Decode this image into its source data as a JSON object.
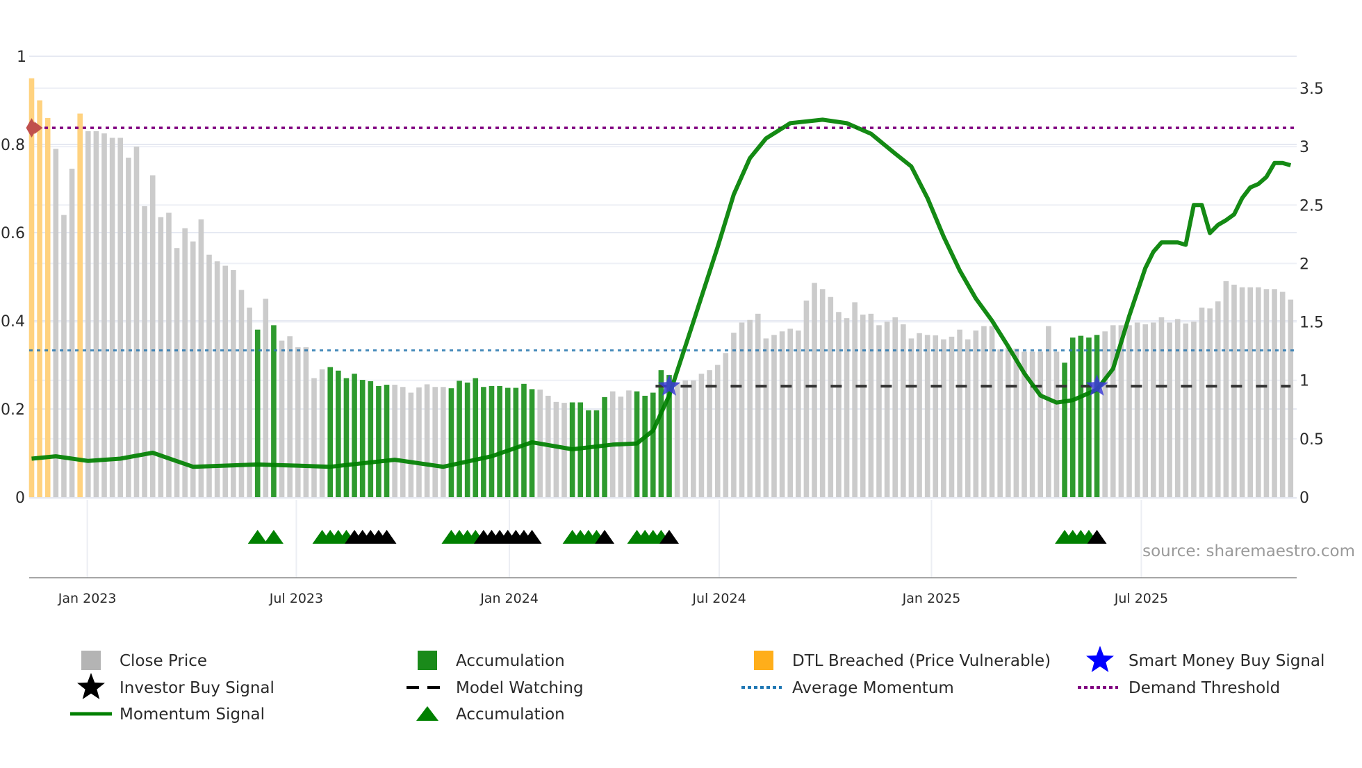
{
  "chart_data": {
    "type": "bar",
    "title": "",
    "source": "source: sharemaestro.com",
    "left_axis": {
      "ticks": [
        0,
        0.2,
        0.4,
        0.6,
        0.8,
        1
      ],
      "labels": [
        "0",
        "0.2",
        "0.4",
        "0.6",
        "0.8",
        "1"
      ],
      "range": [
        0,
        1
      ]
    },
    "right_axis": {
      "ticks": [
        0,
        0.5,
        1,
        1.5,
        2,
        2.5,
        3,
        3.5
      ],
      "labels": [
        "0",
        "0.5",
        "1",
        "1.5",
        "2",
        "2.5",
        "3",
        "3.5"
      ],
      "range": [
        0,
        3.77
      ]
    },
    "x_ticks": [
      {
        "label": "Jan 2023",
        "week": 6.9
      },
      {
        "label": "Jul 2023",
        "week": 32.8
      },
      {
        "label": "Jan 2024",
        "week": 59.2
      },
      {
        "label": "Jul 2024",
        "week": 85.2
      },
      {
        "label": "Jan 2025",
        "week": 111.5
      },
      {
        "label": "Jul 2025",
        "week": 137.5
      }
    ],
    "close_price": [
      0.95,
      0.9,
      0.86,
      0.79,
      0.64,
      0.745,
      0.87,
      0.83,
      0.83,
      0.825,
      0.815,
      0.815,
      0.77,
      0.795,
      0.66,
      0.73,
      0.635,
      0.645,
      0.565,
      0.61,
      0.58,
      0.63,
      0.55,
      0.535,
      0.525,
      0.515,
      0.47,
      0.43,
      0.38,
      0.45,
      0.39,
      0.355,
      0.365,
      0.34,
      0.34,
      0.27,
      0.29,
      0.295,
      0.287,
      0.27,
      0.28,
      0.266,
      0.263,
      0.252,
      0.255,
      0.255,
      0.25,
      0.237,
      0.249,
      0.256,
      0.25,
      0.25,
      0.247,
      0.264,
      0.26,
      0.27,
      0.25,
      0.252,
      0.252,
      0.248,
      0.248,
      0.257,
      0.245,
      0.244,
      0.23,
      0.216,
      0.214,
      0.215,
      0.215,
      0.197,
      0.197,
      0.227,
      0.24,
      0.228,
      0.242,
      0.24,
      0.23,
      0.237,
      0.288,
      0.277,
      0.26,
      0.265,
      0.265,
      0.28,
      0.288,
      0.3,
      0.327,
      0.373,
      0.396,
      0.402,
      0.416,
      0.36,
      0.368,
      0.376,
      0.382,
      0.378,
      0.446,
      0.486,
      0.472,
      0.454,
      0.42,
      0.406,
      0.442,
      0.414,
      0.416,
      0.39,
      0.398,
      0.408,
      0.392,
      0.36,
      0.372,
      0.368,
      0.367,
      0.358,
      0.364,
      0.38,
      0.358,
      0.378,
      0.388,
      0.388,
      0.335,
      0.339,
      0.337,
      0.33,
      0.33,
      0.33,
      0.388,
      0.33,
      0.305,
      0.362,
      0.366,
      0.362,
      0.368,
      0.376,
      0.39,
      0.39,
      0.39,
      0.396,
      0.392,
      0.396,
      0.408,
      0.396,
      0.404,
      0.394,
      0.398,
      0.43,
      0.428,
      0.444,
      0.49,
      0.482,
      0.476,
      0.476,
      0.476,
      0.472,
      0.472,
      0.466,
      0.448
    ],
    "dtl_breached_weeks": [
      0,
      1,
      2,
      6
    ],
    "accumulation_weeks": [
      28,
      30,
      37,
      38,
      39,
      40,
      41,
      42,
      43,
      44,
      52,
      53,
      54,
      55,
      56,
      57,
      58,
      59,
      60,
      61,
      62,
      67,
      68,
      69,
      70,
      71,
      75,
      76,
      77,
      78,
      79,
      128,
      129,
      130,
      131,
      132
    ],
    "momentum_signal": [
      [
        0,
        0.33
      ],
      [
        3,
        0.35
      ],
      [
        7,
        0.31
      ],
      [
        11,
        0.33
      ],
      [
        15,
        0.38
      ],
      [
        20,
        0.26
      ],
      [
        28,
        0.28
      ],
      [
        33,
        0.27
      ],
      [
        37,
        0.26
      ],
      [
        45,
        0.32
      ],
      [
        51,
        0.26
      ],
      [
        57,
        0.35
      ],
      [
        62,
        0.47
      ],
      [
        67,
        0.41
      ],
      [
        72,
        0.45
      ],
      [
        75,
        0.46
      ],
      [
        77,
        0.57
      ],
      [
        79,
        0.87
      ],
      [
        82,
        1.5
      ],
      [
        85,
        2.14
      ],
      [
        87,
        2.59
      ],
      [
        89,
        2.9
      ],
      [
        91,
        3.07
      ],
      [
        94,
        3.2
      ],
      [
        98,
        3.23
      ],
      [
        101,
        3.2
      ],
      [
        104,
        3.11
      ],
      [
        107,
        2.94
      ],
      [
        109,
        2.83
      ],
      [
        111,
        2.56
      ],
      [
        113,
        2.23
      ],
      [
        115,
        1.94
      ],
      [
        117,
        1.7
      ],
      [
        119,
        1.51
      ],
      [
        121,
        1.29
      ],
      [
        123,
        1.06
      ],
      [
        125,
        0.87
      ],
      [
        127,
        0.81
      ],
      [
        129,
        0.83
      ],
      [
        132,
        0.92
      ],
      [
        134,
        1.1
      ],
      [
        136,
        1.55
      ],
      [
        138,
        1.96
      ],
      [
        139,
        2.1
      ],
      [
        140,
        2.18
      ],
      [
        142,
        2.18
      ],
      [
        143,
        2.16
      ],
      [
        144,
        2.5
      ],
      [
        145,
        2.5
      ],
      [
        146,
        2.26
      ],
      [
        147,
        2.33
      ],
      [
        148,
        2.37
      ],
      [
        149,
        2.42
      ],
      [
        150,
        2.56
      ],
      [
        151,
        2.65
      ],
      [
        152,
        2.68
      ],
      [
        153,
        2.74
      ],
      [
        154,
        2.86
      ],
      [
        155,
        2.86
      ],
      [
        156,
        2.84
      ]
    ],
    "demand_threshold": 3.16,
    "average_momentum": 1.256,
    "model_watching": {
      "level": 0.95,
      "from_week": 78
    },
    "smart_money_buy_weeks": [
      79,
      132
    ],
    "dtl_marker_week": 0,
    "accumulation_triangles": [
      28,
      30,
      36,
      37,
      38,
      39,
      52,
      53,
      54,
      55,
      67,
      68,
      69,
      70,
      75,
      76,
      77,
      78,
      128,
      129,
      130,
      131
    ],
    "investor_buy_triangles": [
      40,
      41,
      42,
      43,
      44,
      56,
      57,
      58,
      59,
      60,
      61,
      62,
      71,
      79,
      132
    ],
    "legend": [
      {
        "label": "Close Price",
        "symbol": "gray-square",
        "color": "#b4b4b4"
      },
      {
        "label": "Accumulation",
        "symbol": "green-square",
        "color": "#1a8a1a"
      },
      {
        "label": "DTL Breached (Price Vulnerable)",
        "symbol": "orange-square",
        "color": "#ffae1a"
      },
      {
        "label": "Smart Money Buy Signal",
        "symbol": "blue-star",
        "color": "#0000ff"
      },
      {
        "label": "Investor Buy Signal",
        "symbol": "black-star",
        "color": "#000000"
      },
      {
        "label": "Model Watching",
        "symbol": "black-dash",
        "color": "#000000"
      },
      {
        "label": "Average Momentum",
        "symbol": "blue-dot",
        "color": "#1f77b4"
      },
      {
        "label": "Demand Threshold",
        "symbol": "purple-dot",
        "color": "#800080"
      },
      {
        "label": "Momentum Signal",
        "symbol": "green-line",
        "color": "#008000"
      },
      {
        "label": "Accumulation",
        "symbol": "green-triangle",
        "color": "#008000"
      }
    ],
    "legend_placement": "bottom"
  }
}
